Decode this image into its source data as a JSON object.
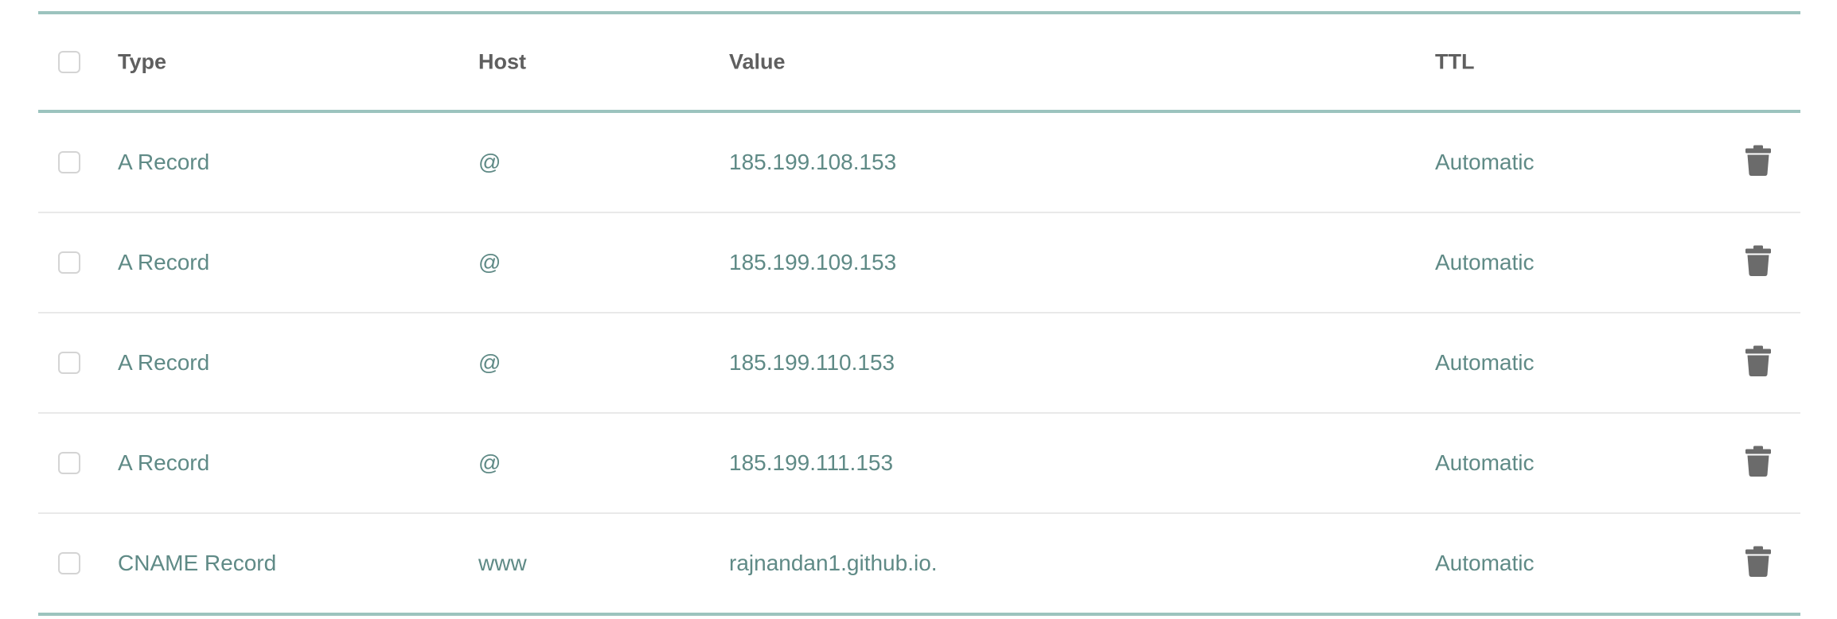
{
  "table": {
    "headers": {
      "type": "Type",
      "host": "Host",
      "value": "Value",
      "ttl": "TTL"
    },
    "rows": [
      {
        "type": "A Record",
        "host": "@",
        "value": "185.199.108.153",
        "ttl": "Automatic"
      },
      {
        "type": "A Record",
        "host": "@",
        "value": "185.199.109.153",
        "ttl": "Automatic"
      },
      {
        "type": "A Record",
        "host": "@",
        "value": "185.199.110.153",
        "ttl": "Automatic"
      },
      {
        "type": "A Record",
        "host": "@",
        "value": "185.199.111.153",
        "ttl": "Automatic"
      },
      {
        "type": "CNAME Record",
        "host": "www",
        "value": "rajnandan1.github.io.",
        "ttl": "Automatic"
      }
    ]
  },
  "icons": {
    "checkbox": "checkbox-unchecked",
    "delete": "trash-icon"
  },
  "colors": {
    "header_border": "#9cc3be",
    "row_divider": "#e9e9e9",
    "header_text": "#5f5f5f",
    "data_text": "#5f8a86",
    "icon": "#6b6b6b"
  }
}
